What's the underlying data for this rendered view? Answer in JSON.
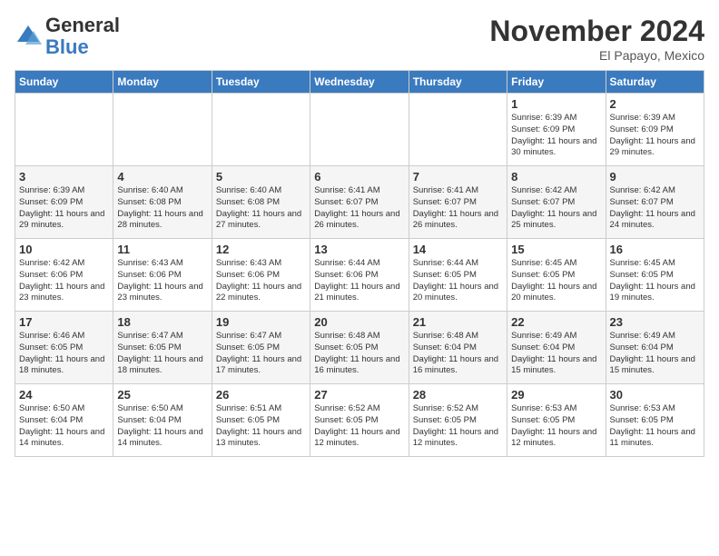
{
  "logo": {
    "text_general": "General",
    "text_blue": "Blue"
  },
  "title": "November 2024",
  "subtitle": "El Papayo, Mexico",
  "days_of_week": [
    "Sunday",
    "Monday",
    "Tuesday",
    "Wednesday",
    "Thursday",
    "Friday",
    "Saturday"
  ],
  "weeks": [
    {
      "alt": false,
      "days": [
        {
          "num": "",
          "info": ""
        },
        {
          "num": "",
          "info": ""
        },
        {
          "num": "",
          "info": ""
        },
        {
          "num": "",
          "info": ""
        },
        {
          "num": "",
          "info": ""
        },
        {
          "num": "1",
          "info": "Sunrise: 6:39 AM\nSunset: 6:09 PM\nDaylight: 11 hours and 30 minutes."
        },
        {
          "num": "2",
          "info": "Sunrise: 6:39 AM\nSunset: 6:09 PM\nDaylight: 11 hours and 29 minutes."
        }
      ]
    },
    {
      "alt": true,
      "days": [
        {
          "num": "3",
          "info": "Sunrise: 6:39 AM\nSunset: 6:09 PM\nDaylight: 11 hours and 29 minutes."
        },
        {
          "num": "4",
          "info": "Sunrise: 6:40 AM\nSunset: 6:08 PM\nDaylight: 11 hours and 28 minutes."
        },
        {
          "num": "5",
          "info": "Sunrise: 6:40 AM\nSunset: 6:08 PM\nDaylight: 11 hours and 27 minutes."
        },
        {
          "num": "6",
          "info": "Sunrise: 6:41 AM\nSunset: 6:07 PM\nDaylight: 11 hours and 26 minutes."
        },
        {
          "num": "7",
          "info": "Sunrise: 6:41 AM\nSunset: 6:07 PM\nDaylight: 11 hours and 26 minutes."
        },
        {
          "num": "8",
          "info": "Sunrise: 6:42 AM\nSunset: 6:07 PM\nDaylight: 11 hours and 25 minutes."
        },
        {
          "num": "9",
          "info": "Sunrise: 6:42 AM\nSunset: 6:07 PM\nDaylight: 11 hours and 24 minutes."
        }
      ]
    },
    {
      "alt": false,
      "days": [
        {
          "num": "10",
          "info": "Sunrise: 6:42 AM\nSunset: 6:06 PM\nDaylight: 11 hours and 23 minutes."
        },
        {
          "num": "11",
          "info": "Sunrise: 6:43 AM\nSunset: 6:06 PM\nDaylight: 11 hours and 23 minutes."
        },
        {
          "num": "12",
          "info": "Sunrise: 6:43 AM\nSunset: 6:06 PM\nDaylight: 11 hours and 22 minutes."
        },
        {
          "num": "13",
          "info": "Sunrise: 6:44 AM\nSunset: 6:06 PM\nDaylight: 11 hours and 21 minutes."
        },
        {
          "num": "14",
          "info": "Sunrise: 6:44 AM\nSunset: 6:05 PM\nDaylight: 11 hours and 20 minutes."
        },
        {
          "num": "15",
          "info": "Sunrise: 6:45 AM\nSunset: 6:05 PM\nDaylight: 11 hours and 20 minutes."
        },
        {
          "num": "16",
          "info": "Sunrise: 6:45 AM\nSunset: 6:05 PM\nDaylight: 11 hours and 19 minutes."
        }
      ]
    },
    {
      "alt": true,
      "days": [
        {
          "num": "17",
          "info": "Sunrise: 6:46 AM\nSunset: 6:05 PM\nDaylight: 11 hours and 18 minutes."
        },
        {
          "num": "18",
          "info": "Sunrise: 6:47 AM\nSunset: 6:05 PM\nDaylight: 11 hours and 18 minutes."
        },
        {
          "num": "19",
          "info": "Sunrise: 6:47 AM\nSunset: 6:05 PM\nDaylight: 11 hours and 17 minutes."
        },
        {
          "num": "20",
          "info": "Sunrise: 6:48 AM\nSunset: 6:05 PM\nDaylight: 11 hours and 16 minutes."
        },
        {
          "num": "21",
          "info": "Sunrise: 6:48 AM\nSunset: 6:04 PM\nDaylight: 11 hours and 16 minutes."
        },
        {
          "num": "22",
          "info": "Sunrise: 6:49 AM\nSunset: 6:04 PM\nDaylight: 11 hours and 15 minutes."
        },
        {
          "num": "23",
          "info": "Sunrise: 6:49 AM\nSunset: 6:04 PM\nDaylight: 11 hours and 15 minutes."
        }
      ]
    },
    {
      "alt": false,
      "days": [
        {
          "num": "24",
          "info": "Sunrise: 6:50 AM\nSunset: 6:04 PM\nDaylight: 11 hours and 14 minutes."
        },
        {
          "num": "25",
          "info": "Sunrise: 6:50 AM\nSunset: 6:04 PM\nDaylight: 11 hours and 14 minutes."
        },
        {
          "num": "26",
          "info": "Sunrise: 6:51 AM\nSunset: 6:05 PM\nDaylight: 11 hours and 13 minutes."
        },
        {
          "num": "27",
          "info": "Sunrise: 6:52 AM\nSunset: 6:05 PM\nDaylight: 11 hours and 12 minutes."
        },
        {
          "num": "28",
          "info": "Sunrise: 6:52 AM\nSunset: 6:05 PM\nDaylight: 11 hours and 12 minutes."
        },
        {
          "num": "29",
          "info": "Sunrise: 6:53 AM\nSunset: 6:05 PM\nDaylight: 11 hours and 12 minutes."
        },
        {
          "num": "30",
          "info": "Sunrise: 6:53 AM\nSunset: 6:05 PM\nDaylight: 11 hours and 11 minutes."
        }
      ]
    }
  ]
}
